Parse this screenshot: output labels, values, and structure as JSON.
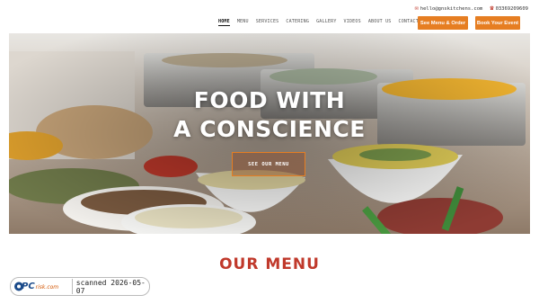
{
  "topbar": {
    "email": "hello@gnskitchens.com",
    "phone": "03369209609",
    "email_icon": "envelope-icon",
    "phone_icon": "phone-icon"
  },
  "nav": {
    "items": [
      "HOME",
      "MENU",
      "SERVICES",
      "CATERING",
      "GALLERY",
      "VIDEOS",
      "ABOUT US",
      "CONTACT US"
    ],
    "active": "HOME"
  },
  "buttons": {
    "menu_order": "See Menu & Order",
    "book_event": "Book Your Event"
  },
  "hero": {
    "title_line1": "FOOD WITH",
    "title_line2": "A CONSCIENCE",
    "cta": "SEE OUR MENU"
  },
  "section": {
    "title": "OUR MENU"
  },
  "badge": {
    "logo_text": "PCrisk.com",
    "scan_text": "scanned 2026-05-07"
  },
  "colors": {
    "accent": "#e67e22",
    "heading": "#c0392b"
  }
}
